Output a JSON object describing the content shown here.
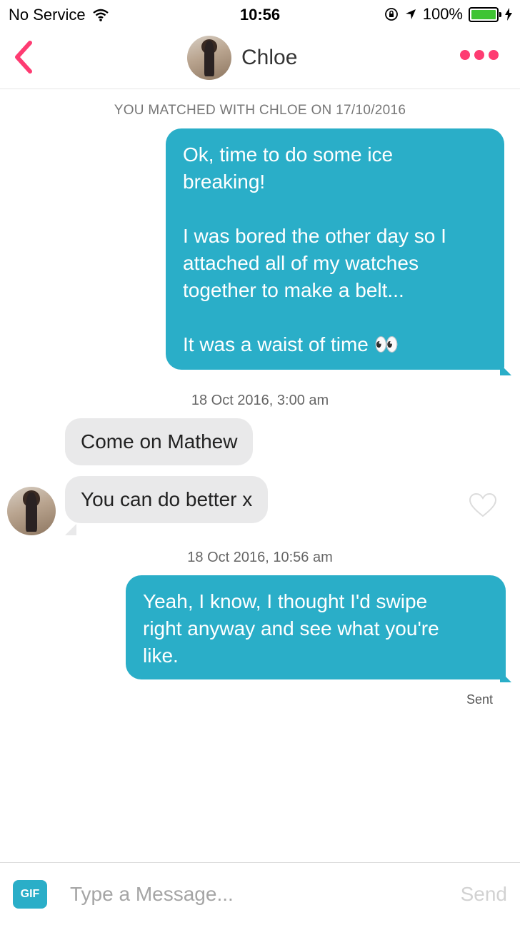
{
  "status_bar": {
    "carrier": "No Service",
    "time": "10:56",
    "battery": "100%",
    "battery_level": 1.0
  },
  "header": {
    "contact_name": "Chloe",
    "back_icon": "chevron-left-icon",
    "more_icon": "more-dots-icon",
    "accent_color": "#fe3c72"
  },
  "conversation": {
    "match_notice": "YOU MATCHED WITH CHLOE ON 17/10/2016",
    "messages": [
      {
        "direction": "outgoing",
        "lines": [
          "Ok, time to do some ice",
          "breaking!",
          "",
          "I was bored the other day so I",
          "attached all of my watches",
          "together to make a belt...",
          "",
          "It was a waist of time 👀"
        ]
      },
      {
        "timestamp": "18 Oct 2016, 3:00 am"
      },
      {
        "direction": "incoming",
        "text": "Come on Mathew"
      },
      {
        "direction": "incoming",
        "text": "You can do better x"
      },
      {
        "timestamp": "18 Oct 2016, 10:56 am"
      },
      {
        "direction": "outgoing",
        "lines": [
          "Yeah, I know, I thought I'd swipe",
          "right anyway and see what you're",
          "like."
        ]
      }
    ],
    "delivery_status": "Sent",
    "outgoing_color": "#2aaec8",
    "incoming_color": "#e9e9ea"
  },
  "composer": {
    "gif_label": "GIF",
    "placeholder": "Type a Message...",
    "send_label": "Send"
  }
}
